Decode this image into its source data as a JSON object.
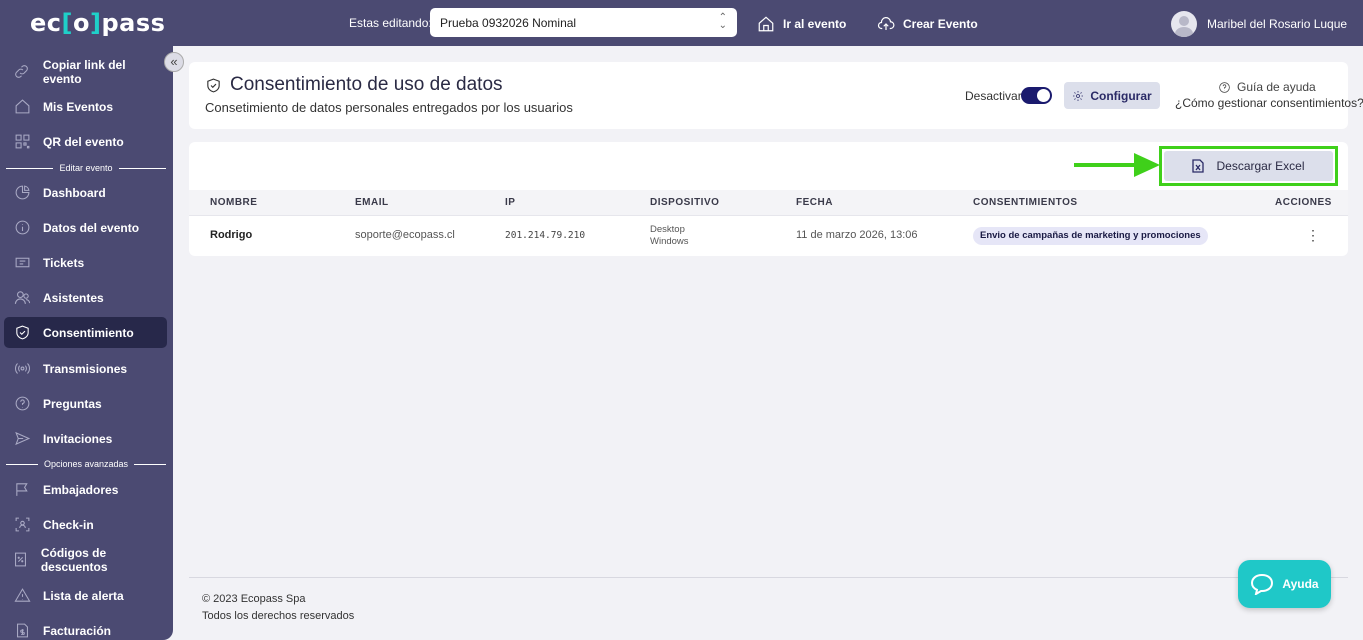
{
  "brand": {
    "logo_pre": "ec",
    "logo_bracket_open": "[",
    "logo_mid": "o",
    "logo_bracket_close": "]",
    "logo_post": "pass"
  },
  "topbar": {
    "editing_label": "Estas editando:",
    "event_selected": "Prueba 0932026 Nominal",
    "goto_event": "Ir al evento",
    "create_event": "Crear Evento",
    "user_name": "Maribel del Rosario Luque"
  },
  "sidebar": {
    "items": [
      {
        "label": "Copiar link del evento",
        "icon": "link-icon"
      },
      {
        "label": "Mis Eventos",
        "icon": "home-icon"
      },
      {
        "label": "QR del evento",
        "icon": "qr-icon"
      },
      {
        "label": "Dashboard",
        "icon": "pie-chart-icon"
      },
      {
        "label": "Datos del evento",
        "icon": "info-icon"
      },
      {
        "label": "Tickets",
        "icon": "ticket-icon"
      },
      {
        "label": "Asistentes",
        "icon": "users-icon"
      },
      {
        "label": "Consentimiento",
        "icon": "shield-check-icon",
        "active": true
      },
      {
        "label": "Transmisiones",
        "icon": "broadcast-icon"
      },
      {
        "label": "Preguntas",
        "icon": "question-icon"
      },
      {
        "label": "Invitaciones",
        "icon": "send-icon"
      },
      {
        "label": "Embajadores",
        "icon": "flag-icon"
      },
      {
        "label": "Check-in",
        "icon": "checkin-icon"
      },
      {
        "label": "Códigos de descuentos",
        "icon": "discount-icon"
      },
      {
        "label": "Lista de alerta",
        "icon": "alert-icon"
      },
      {
        "label": "Facturación",
        "icon": "invoice-icon"
      }
    ],
    "divider_edit": "Editar evento",
    "divider_advanced": "Opciones avanzadas"
  },
  "page": {
    "title": "Consentimiento de uso de datos",
    "subtitle": "Consetimiento de datos personales entregados por los usuarios",
    "toggle_label": "Desactivar",
    "toggle_on": true,
    "configure": "Configurar",
    "help_title": "Guía de ayuda",
    "help_link": "¿Cómo gestionar consentimientos?"
  },
  "table": {
    "download": "Descargar Excel",
    "columns": [
      "NOMBRE",
      "EMAIL",
      "IP",
      "DISPOSITIVO",
      "FECHA",
      "CONSENTIMIENTOS",
      "ACCIONES"
    ],
    "rows": [
      {
        "nombre": "Rodrigo",
        "email": "soporte@ecopass.cl",
        "ip": "201.214.79.210",
        "device": "Desktop",
        "os": "Windows",
        "fecha": "11 de marzo 2026, 13:06",
        "consent": "Envio de campañas de marketing y promociones"
      }
    ]
  },
  "footer": {
    "copyright": "© 2023 Ecopass Spa",
    "rights": "Todos los derechos reservados"
  },
  "help_widget": {
    "label": "Ayuda"
  },
  "colors": {
    "topbar": "#4b4a72",
    "accent": "#1fd0c9",
    "highlight": "#3fd01a",
    "active_item": "#27284a"
  }
}
